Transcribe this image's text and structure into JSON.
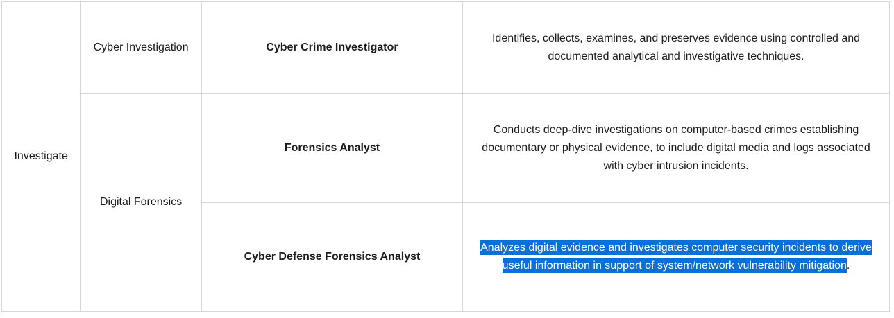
{
  "table": {
    "category": "Investigate",
    "specialties": {
      "cyber_investigation": "Cyber Investigation",
      "digital_forensics": "Digital Forensics"
    },
    "rows": [
      {
        "role": "Cyber Crime Investigator",
        "description": "Identifies, collects, examines, and preserves evidence using controlled and documented analytical and investigative techniques."
      },
      {
        "role": "Forensics Analyst",
        "description": "Conducts deep-dive investigations on computer-based crimes establishing documentary or physical evidence, to include digital media and logs associated with cyber intrusion incidents."
      },
      {
        "role": "Cyber Defense Forensics Analyst",
        "description_selected": "Analyzes digital evidence and investigates computer security incidents to derive useful information in support of system/network vulnerability mitigation",
        "description_tail": "."
      }
    ]
  },
  "colors": {
    "selection_background": "#0a6fd6",
    "selection_text": "#ffffff",
    "border": "#d6d6d6"
  }
}
